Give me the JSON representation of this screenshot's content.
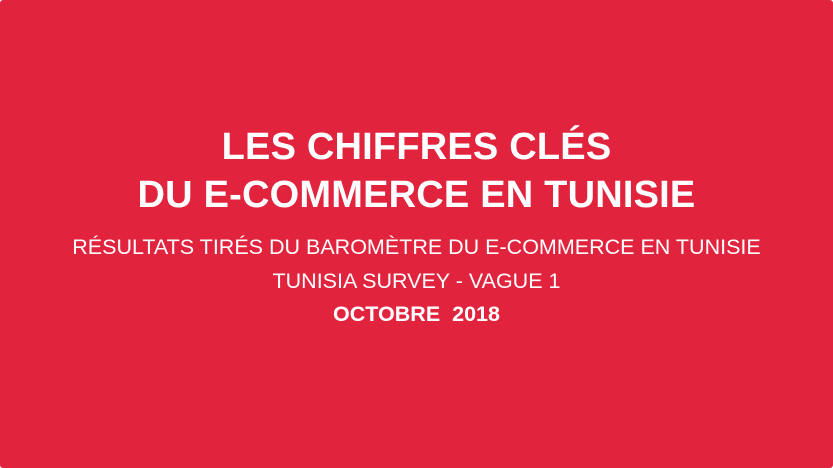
{
  "slide": {
    "background_color": "#e1233d",
    "text_color": "#ffffff",
    "title_line_1": "LES CHIFFRES CLÉS",
    "title_line_2": "DU E-COMMERCE EN TUNISIE",
    "subtitle_line_1": "RÉSULTATS TIRÉS DU BAROMÈTRE DU E-COMMERCE EN TUNISIE",
    "subtitle_line_2": "TUNISIA SURVEY - VAGUE 1",
    "date": "OCTOBRE  2018"
  }
}
